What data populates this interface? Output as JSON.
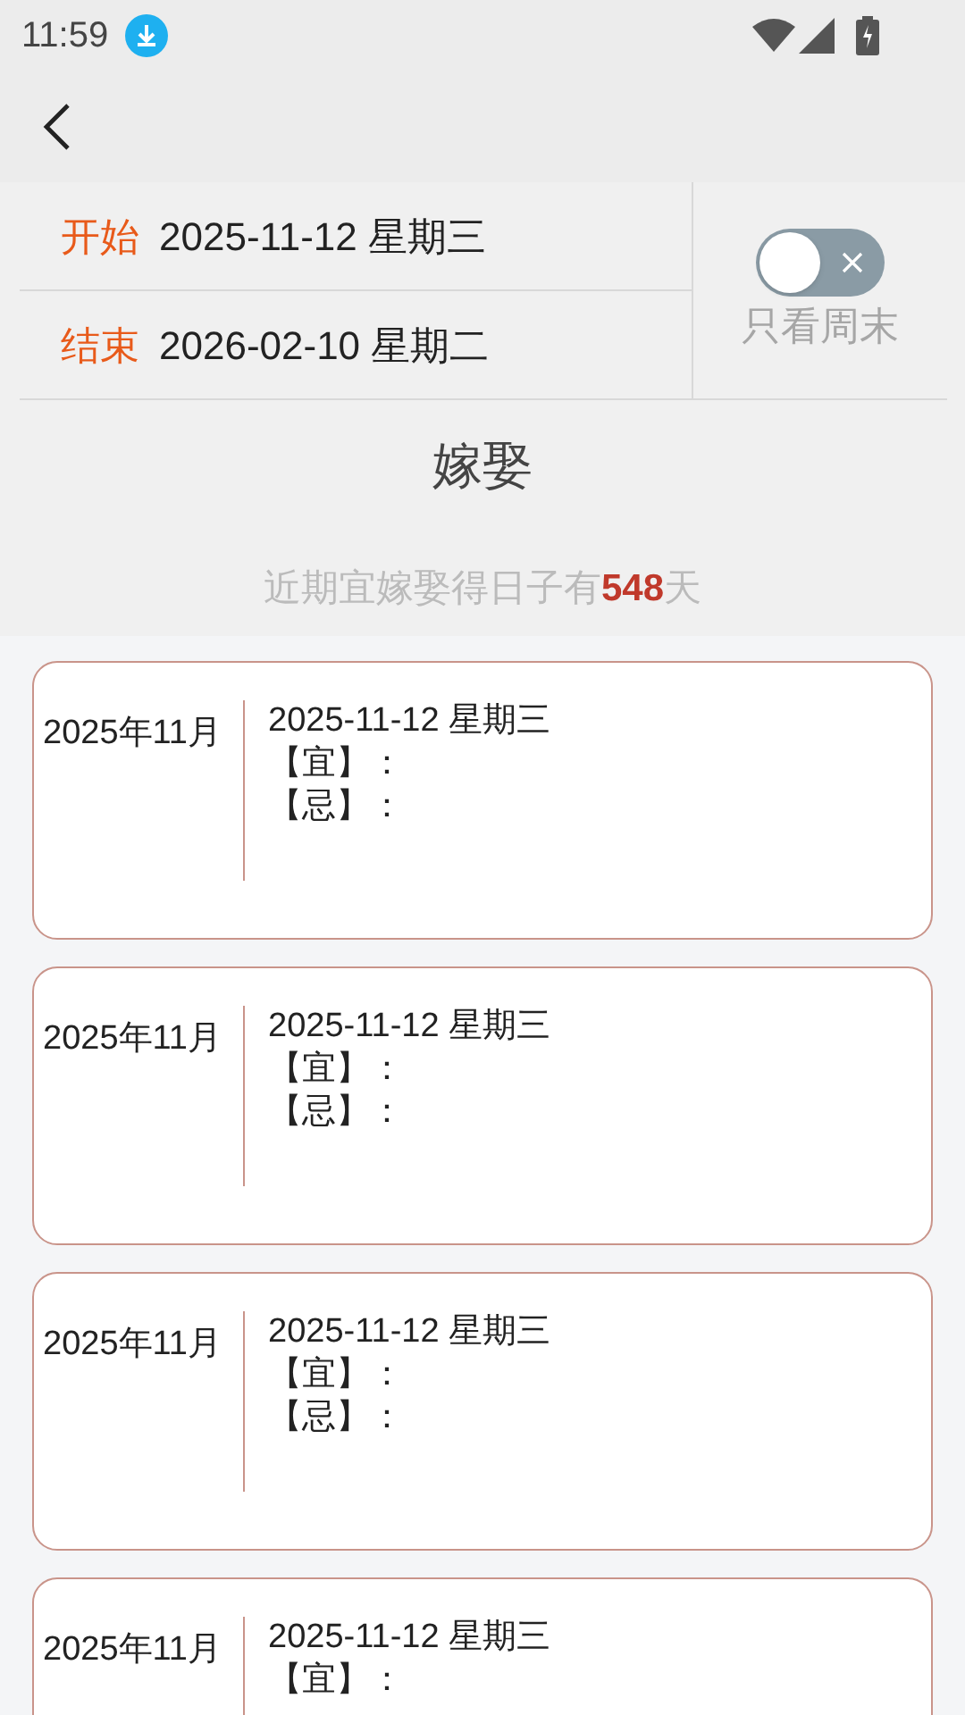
{
  "status_bar": {
    "time": "11:59"
  },
  "range": {
    "start_label": "开始",
    "start_value": "2025-11-12 星期三",
    "end_label": "结束",
    "end_value": "2026-02-10 星期二"
  },
  "weekend_toggle": {
    "on": false,
    "label": "只看周末"
  },
  "title": "嫁娶",
  "summary": {
    "prefix": "近期宜嫁娶得日子有",
    "count": "548",
    "suffix": "天"
  },
  "cards": [
    {
      "month": "2025年11月",
      "date": "2025-11-12 星期三",
      "yi": "【宜】：",
      "ji": "【忌】："
    },
    {
      "month": "2025年11月",
      "date": "2025-11-12 星期三",
      "yi": "【宜】：",
      "ji": "【忌】："
    },
    {
      "month": "2025年11月",
      "date": "2025-11-12 星期三",
      "yi": "【宜】：",
      "ji": "【忌】："
    },
    {
      "month": "2025年11月",
      "date": "2025-11-12 星期三",
      "yi": "【宜】："
    }
  ]
}
